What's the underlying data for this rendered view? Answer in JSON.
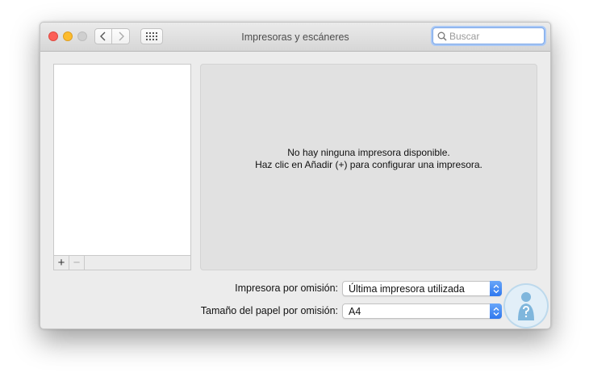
{
  "window": {
    "title": "Impresoras y escáneres"
  },
  "toolbar": {
    "back_icon": "chevron-left-icon",
    "forward_icon": "chevron-right-icon",
    "show_all_icon": "grid-icon"
  },
  "search": {
    "placeholder": "Buscar",
    "value": "",
    "icon": "search-icon"
  },
  "printer_list": {
    "items": [],
    "add_label": "+",
    "remove_label": "−"
  },
  "detail": {
    "message_line1": "No hay ninguna impresora disponible.",
    "message_line2": "Haz clic en Añadir (+) para configurar una impresora."
  },
  "settings": {
    "default_printer_label": "Impresora por omisión:",
    "default_printer_value": "Última impresora utilizada",
    "paper_size_label": "Tamaño del papel por omisión:",
    "paper_size_value": "A4"
  },
  "colors": {
    "close": "#fc5f57",
    "minimize": "#fdbc2e",
    "zoom_disabled": "#cfcfcf",
    "popup_accent": "#3a82f2",
    "search_focus": "#a9c8f6"
  }
}
